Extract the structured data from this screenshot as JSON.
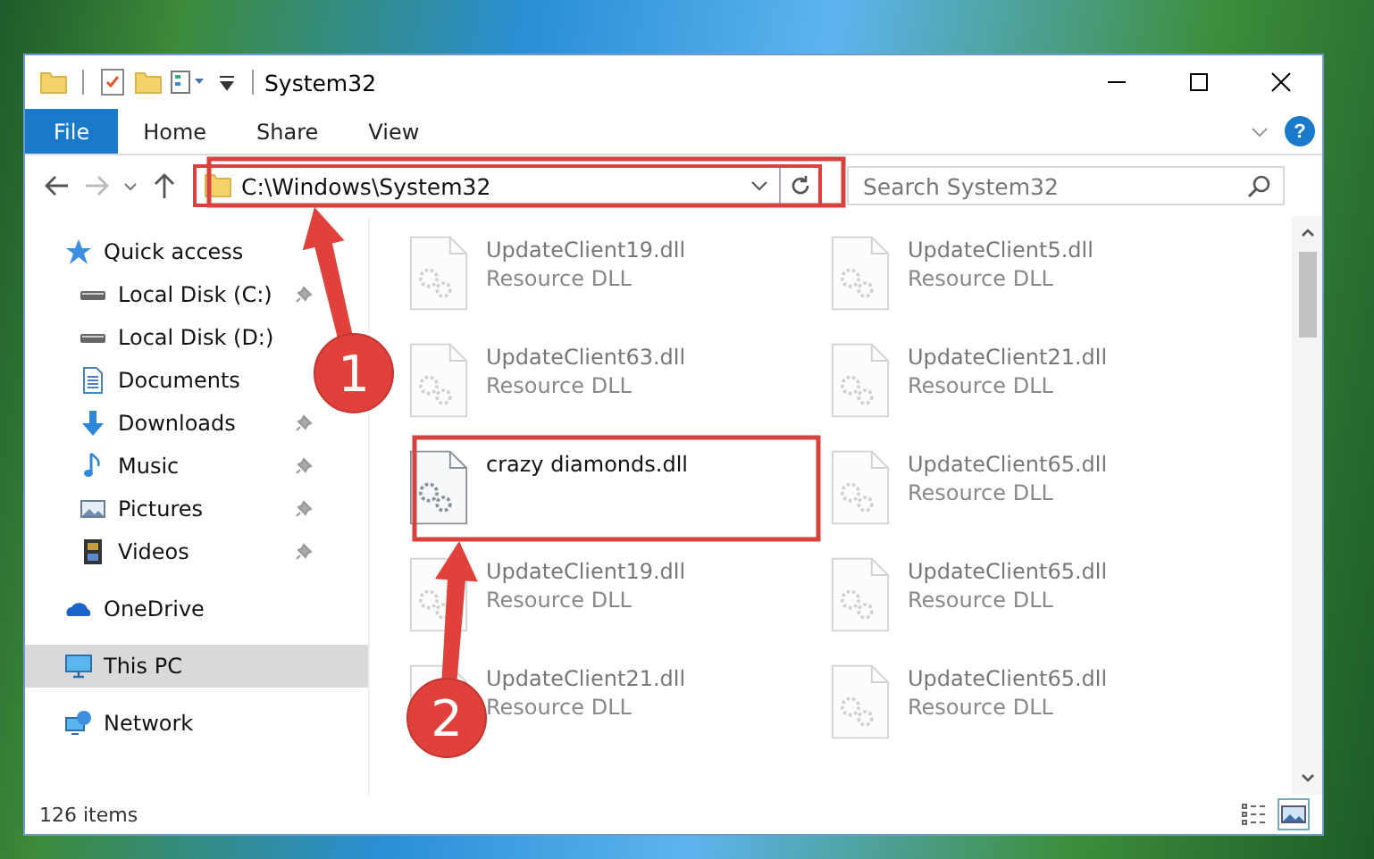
{
  "window": {
    "title": "System32"
  },
  "ribbon_tabs": [
    {
      "label": "File",
      "selected": true
    },
    {
      "label": "Home",
      "selected": false
    },
    {
      "label": "Share",
      "selected": false
    },
    {
      "label": "View",
      "selected": false
    }
  ],
  "help": {
    "label": "?"
  },
  "address_bar": {
    "value": "C:\\Windows\\System32"
  },
  "search": {
    "placeholder": "Search System32"
  },
  "sidebar": {
    "items": [
      {
        "label": "Quick access",
        "selected": false,
        "children": [
          {
            "label": "Local Disk (C:)",
            "pinned": true,
            "selected": false
          },
          {
            "label": "Local Disk (D:)",
            "pinned": false,
            "selected": false
          },
          {
            "label": "Documents",
            "pinned": false,
            "selected": false
          },
          {
            "label": "Downloads",
            "pinned": true,
            "selected": false
          },
          {
            "label": "Music",
            "pinned": true,
            "selected": false
          },
          {
            "label": "Pictures",
            "pinned": true,
            "selected": false
          },
          {
            "label": "Videos",
            "pinned": true,
            "selected": false
          }
        ]
      },
      {
        "label": "OneDrive",
        "selected": false
      },
      {
        "label": "This PC",
        "selected": true
      },
      {
        "label": "Network",
        "selected": false
      }
    ]
  },
  "files": [
    {
      "name": "UpdateClient19.dll",
      "type": "Resource DLL",
      "faded": true
    },
    {
      "name": "UpdateClient5.dll",
      "type": "Resource DLL",
      "faded": true
    },
    {
      "name": "UpdateClient63.dll",
      "type": "Resource DLL",
      "faded": true
    },
    {
      "name": "UpdateClient21.dll",
      "type": "Resource DLL",
      "faded": true
    },
    {
      "name": "crazy diamonds.dll",
      "faded": false
    },
    {
      "name": "UpdateClient65.dll",
      "type": "Resource DLL",
      "faded": true
    },
    {
      "name": "UpdateClient19.dll",
      "type": "Resource DLL",
      "faded": true
    },
    {
      "name": "UpdateClient65.dll",
      "type": "Resource DLL",
      "faded": true
    },
    {
      "name": "UpdateClient21.dll",
      "type": "Resource DLL",
      "faded": true
    },
    {
      "name": "UpdateClient65.dll",
      "type": "Resource DLL",
      "faded": true
    }
  ],
  "status_bar": {
    "item_count": "126 items"
  },
  "annotations": [
    {
      "label": "1"
    },
    {
      "label": "2"
    }
  ]
}
